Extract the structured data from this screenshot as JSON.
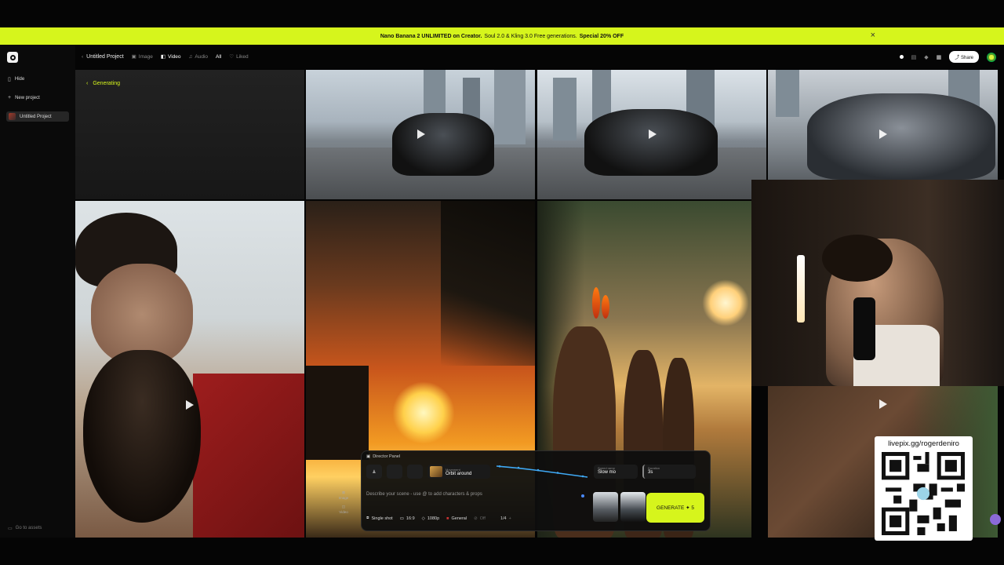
{
  "banner": {
    "text_main": "Nano Banana 2 UNLIMITED on Creator.",
    "text_rest": "Soul 2.0 & Kling 3.0 Free generations.",
    "text_offer": "Special 20% OFF",
    "close": "×"
  },
  "sidebar": {
    "hide": "Hide",
    "new_project": "New project",
    "project": "Untitled Project",
    "go_assets": "Go to assets"
  },
  "topbar": {
    "back": "‹",
    "title": "Untitled Project",
    "tabs": [
      {
        "label": "Image",
        "icon": "▣"
      },
      {
        "label": "Video",
        "icon": "◧"
      },
      {
        "label": "Audio",
        "icon": "♫"
      },
      {
        "label": "All"
      },
      {
        "label": "Liked",
        "icon": "♡"
      }
    ],
    "share": "Share",
    "share_icon": "⤴"
  },
  "grid": {
    "generating": "Generating",
    "chevron": "‹"
  },
  "qr": {
    "text": "livepix.gg/rogerdeniro"
  },
  "director": {
    "title": "Director Panel",
    "movement_label": "Movement",
    "movement": "Orbit around",
    "speed_label": "Speed ramp",
    "speed": "Slow mo",
    "duration_label": "Duration",
    "duration": "3s",
    "prompt_placeholder": "Describe your scene - use @ to add characters & props",
    "mode_image": "Image",
    "mode_video": "Video",
    "options": {
      "shot": "Single shot",
      "ratio": "16:9",
      "resolution": "1080p",
      "style": "General",
      "off": "Off",
      "count": "1/4",
      "plus": "+"
    },
    "generate": "GENERATE ✦ 5"
  },
  "colors": {
    "accent": "#d6f51c",
    "background": "#050505"
  },
  "icons": [
    "logo-icon",
    "hide-icon",
    "plus-icon",
    "close-icon",
    "play-icon",
    "grid-icon",
    "share-icon",
    "qr-code"
  ]
}
